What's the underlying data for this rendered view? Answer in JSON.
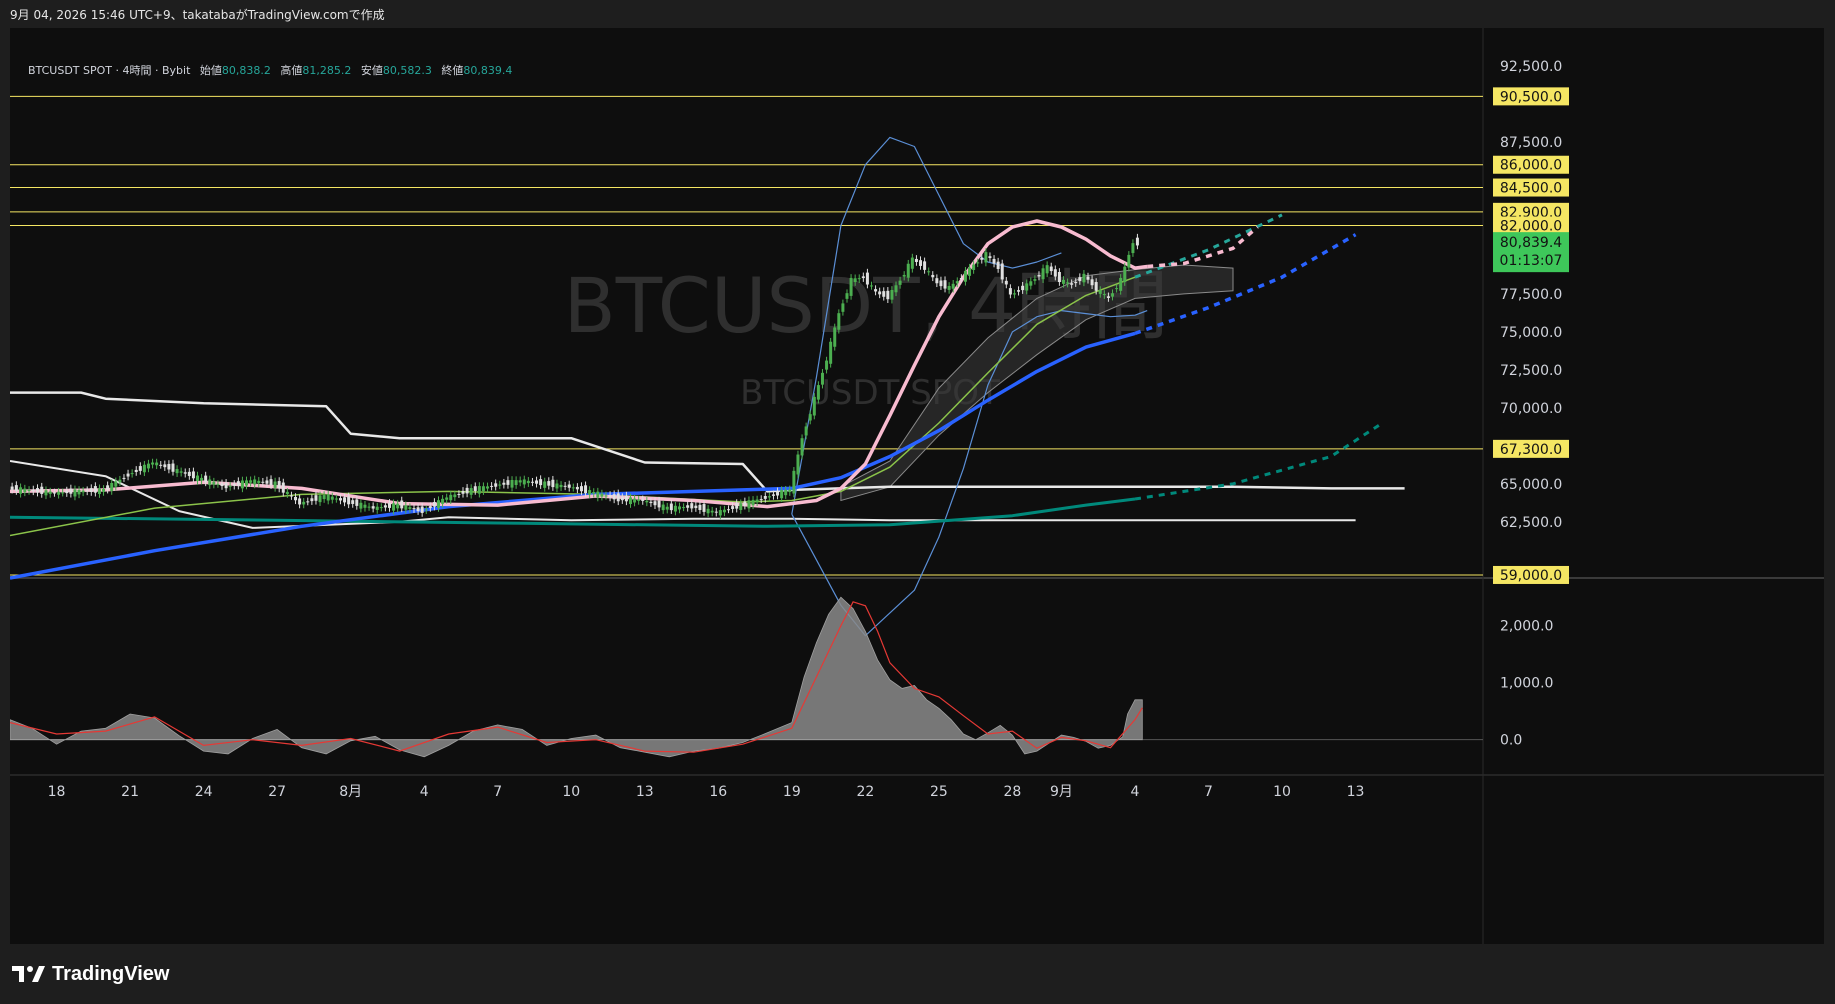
{
  "header": {
    "text": "9月 04, 2026 15:46 UTC+9、takatabaがTradingView.comで作成"
  },
  "legend": {
    "symbol": "BTCUSDT SPOT · 4時間 · Bybit",
    "open_label": "始値",
    "open": "80,838.2",
    "high_label": "高値",
    "high": "81,285.2",
    "low_label": "安値",
    "low": "80,582.3",
    "close_label": "終値",
    "close": "80,839.4"
  },
  "watermark": {
    "main": "BTCUSDT, 4時間",
    "sub": "BTCUSDT SPOT"
  },
  "footer": {
    "brand": "TradingView"
  },
  "colors": {
    "background": "#0e0e0e",
    "horizontal_line": "#f5e663",
    "up_candle": "#4caf50",
    "down_candle": "#e0e0e0",
    "pink_ma": "#f8bbd0",
    "blue_ma": "#2962ff",
    "teal_ma": "#00897b",
    "green_ma": "#8bc34a",
    "bollinger": "#5b8fd6",
    "histogram": "#8a8a8a",
    "signal": "#e53935",
    "last_price_tag": "#3ec75a"
  },
  "chart_data": {
    "type": "line",
    "title": "BTCUSDT, 4時間",
    "y_axis": {
      "ticks": [
        "92,500.0",
        "87,500.0",
        "77,500.0",
        "75,000.0",
        "72,500.0",
        "70,000.0",
        "65,000.0",
        "62,500.0"
      ],
      "tick_values": [
        92500,
        87500,
        77500,
        75000,
        72500,
        70000,
        65000,
        62500
      ],
      "range": [
        58800,
        95000
      ]
    },
    "x_axis": {
      "ticks": [
        "18",
        "21",
        "24",
        "27",
        "8月",
        "4",
        "7",
        "10",
        "13",
        "16",
        "19",
        "22",
        "25",
        "28",
        "9月",
        "4",
        "7",
        "10",
        "13"
      ],
      "tick_days": [
        -44,
        -41,
        -38,
        -35,
        -32,
        -29,
        -26,
        -23,
        -20,
        -17,
        -14,
        -11,
        -8,
        -5,
        -3,
        0,
        3,
        6,
        9
      ],
      "range_days": [
        -45.9,
        14.2
      ]
    },
    "horizontal_levels": [
      {
        "label": "90,500.0",
        "value": 90500
      },
      {
        "label": "86,000.0",
        "value": 86000
      },
      {
        "label": "84,500.0",
        "value": 84500
      },
      {
        "label": "82,900.0",
        "value": 82900
      },
      {
        "label": "82,000.0",
        "value": 82000
      },
      {
        "label": "67,300.0",
        "value": 67300
      },
      {
        "label": "59,000.0",
        "value": 59000
      }
    ],
    "last_price": {
      "label": "80,839.4",
      "countdown": "01:13:07",
      "value": 80839.4
    },
    "price_series": {
      "name": "BTCUSDT",
      "days": [
        -45.9,
        -44,
        -42,
        -41,
        -40,
        -38,
        -37,
        -36,
        -35,
        -34,
        -33,
        -32,
        -31,
        -30,
        -29,
        -28,
        -27,
        -26,
        -25,
        -24,
        -23,
        -22,
        -21,
        -20,
        -19,
        -18,
        -17,
        -16,
        -15,
        -14,
        -13.5,
        -13,
        -12.5,
        -12,
        -11.5,
        -11,
        -10.5,
        -10,
        -9.5,
        -9,
        -8.5,
        -8,
        -7.5,
        -7,
        -6.5,
        -6,
        -5.5,
        -5,
        -4.5,
        -4,
        -3.5,
        -3,
        -2.5,
        -2,
        -1.5,
        -1,
        -0.5,
        0,
        0.2
      ],
      "values": [
        64700,
        64400,
        64600,
        65600,
        66400,
        65300,
        64800,
        65200,
        65000,
        63700,
        64200,
        63800,
        63400,
        63600,
        63200,
        64100,
        64600,
        64900,
        65200,
        65000,
        64800,
        64400,
        64000,
        63900,
        63400,
        63500,
        63100,
        63600,
        64100,
        64600,
        68000,
        70600,
        73200,
        76200,
        78400,
        78600,
        77600,
        77300,
        78400,
        79800,
        79200,
        78200,
        77900,
        78600,
        79400,
        80100,
        79200,
        77400,
        77900,
        78500,
        79300,
        78400,
        78100,
        78700,
        77800,
        77200,
        78400,
        80900,
        80839
      ]
    },
    "pink_ma": {
      "days": [
        -45.9,
        -42,
        -38,
        -34,
        -30,
        -26,
        -22,
        -18,
        -15,
        -13,
        -12,
        -11,
        -10,
        -9,
        -8,
        -7,
        -6,
        -5,
        -4,
        -3,
        -2,
        -1,
        0,
        0.5
      ],
      "values": [
        64500,
        64600,
        65100,
        64700,
        63700,
        63600,
        64200,
        63900,
        63500,
        63900,
        64700,
        66300,
        69500,
        72800,
        76000,
        78600,
        80800,
        81900,
        82300,
        81900,
        81100,
        80000,
        79200,
        79300
      ]
    },
    "pink_ma_projection": {
      "days": [
        0.5,
        2,
        4,
        5
      ],
      "values": [
        79300,
        79500,
        80500,
        81900
      ]
    },
    "blue_ma": {
      "days": [
        -45.9,
        -40,
        -34,
        -28,
        -22,
        -16,
        -14,
        -12,
        -10,
        -8,
        -6,
        -4,
        -2,
        0
      ],
      "values": [
        58800,
        60600,
        62200,
        63500,
        64300,
        64600,
        64700,
        65400,
        66800,
        68500,
        70500,
        72400,
        74000,
        74900
      ]
    },
    "blue_ma_projection": {
      "days": [
        0,
        3,
        6,
        9
      ],
      "values": [
        74900,
        76600,
        78600,
        81400
      ]
    },
    "green_ma": {
      "days": [
        -45.9,
        -40,
        -34,
        -28,
        -22,
        -16,
        -14,
        -12,
        -10,
        -8,
        -6,
        -4,
        -2,
        0
      ],
      "values": [
        61600,
        63400,
        64300,
        64500,
        64300,
        63800,
        63900,
        64500,
        66100,
        69000,
        72300,
        75500,
        77400,
        78600
      ]
    },
    "green_ma_projection": {
      "days": [
        0,
        3,
        6
      ],
      "values": [
        78600,
        80400,
        82700
      ]
    },
    "teal_ma": {
      "days": [
        -45.9,
        -35,
        -25,
        -15,
        -10,
        -5,
        -2,
        0
      ],
      "values": [
        62800,
        62600,
        62400,
        62200,
        62300,
        62900,
        63600,
        64000
      ]
    },
    "teal_ma_projection": {
      "days": [
        0,
        4,
        8,
        10
      ],
      "values": [
        64000,
        65000,
        66800,
        68900
      ]
    },
    "white_step_line": {
      "days": [
        -45.9,
        -43,
        -42,
        -38,
        -33,
        -32,
        -30,
        -23,
        -20,
        -16,
        -15,
        -14,
        -10,
        -6,
        -3,
        -3,
        1,
        4,
        8,
        11
      ],
      "values": [
        71000,
        71000,
        70600,
        70300,
        70100,
        68300,
        68000,
        68000,
        66400,
        66300,
        64500,
        64600,
        64800,
        64800,
        64800,
        64800,
        64800,
        64800,
        64700,
        64700
      ]
    },
    "white_lower_line": {
      "days": [
        -45.9,
        -42,
        -39,
        -36,
        -30,
        -28,
        -23,
        -18,
        -14,
        -10,
        -4,
        0,
        4,
        9
      ],
      "values": [
        66500,
        65500,
        63200,
        62100,
        62500,
        62800,
        62600,
        62700,
        62700,
        62600,
        62600,
        62600,
        62600,
        62600
      ]
    },
    "bollinger_upper": {
      "days": [
        -14,
        -13,
        -12,
        -11,
        -10,
        -9,
        -8,
        -7,
        -6,
        -5,
        -4,
        -3
      ],
      "values": [
        63000,
        72000,
        82000,
        86000,
        87800,
        87200,
        84000,
        80800,
        79600,
        79200,
        79600,
        80200
      ]
    },
    "bollinger_lower": {
      "days": [
        -14,
        -13,
        -12,
        -11,
        -10,
        -9,
        -8,
        -7,
        -6,
        -5,
        -4,
        -3,
        -2,
        -1,
        0,
        0.5
      ],
      "values": [
        63000,
        60000,
        57000,
        55000,
        56500,
        58000,
        61500,
        66000,
        71500,
        75000,
        76000,
        76400,
        76200,
        76000,
        76100,
        76400
      ]
    },
    "cloud_upper": {
      "days": [
        -12,
        -10,
        -8,
        -6,
        -4,
        -2,
        0,
        2,
        4
      ],
      "values": [
        64800,
        66500,
        71300,
        74600,
        77200,
        78700,
        79100,
        79400,
        79200
      ]
    },
    "cloud_lower": {
      "days": [
        -12,
        -10,
        -8,
        -6,
        -4,
        -2,
        0,
        2,
        4
      ],
      "values": [
        63900,
        64800,
        68200,
        71000,
        73500,
        75800,
        77200,
        77500,
        77700
      ]
    },
    "oscillator": {
      "name": "oscillator",
      "y_ticks": [
        "2,000.0",
        "1,000.0",
        "0.0"
      ],
      "y_tick_values": [
        2000,
        1000,
        0
      ],
      "range": [
        -620,
        2820
      ],
      "days": [
        -45.9,
        -45,
        -44,
        -43,
        -42,
        -41,
        -40,
        -39,
        -38,
        -37,
        -36,
        -35,
        -34,
        -33,
        -32,
        -31,
        -30,
        -29,
        -28,
        -27,
        -26,
        -25,
        -24,
        -23,
        -22,
        -21,
        -20,
        -19,
        -18,
        -17,
        -16,
        -15,
        -14,
        -13.5,
        -13,
        -12.5,
        -12,
        -11.5,
        -11,
        -10.5,
        -10,
        -9.5,
        -9,
        -8.5,
        -8,
        -7.5,
        -7,
        -6.5,
        -6,
        -5.5,
        -5,
        -4.5,
        -4,
        -3.5,
        -3,
        -2.5,
        -2,
        -1.5,
        -1,
        -0.5,
        -0.3,
        0,
        0.3
      ],
      "values": [
        350,
        200,
        -80,
        150,
        200,
        450,
        380,
        70,
        -200,
        -250,
        20,
        180,
        -140,
        -250,
        -20,
        60,
        -180,
        -300,
        -100,
        150,
        260,
        180,
        -100,
        20,
        80,
        -140,
        -220,
        -300,
        -200,
        -150,
        -50,
        120,
        300,
        1100,
        1700,
        2200,
        2500,
        2300,
        1900,
        1400,
        1050,
        900,
        950,
        700,
        550,
        350,
        100,
        0,
        120,
        250,
        80,
        -250,
        -200,
        -60,
        80,
        40,
        -30,
        -150,
        -100,
        50,
        450,
        700,
        700
      ]
    },
    "signal": {
      "days": [
        -45.9,
        -44,
        -42,
        -40,
        -38,
        -36,
        -34,
        -32,
        -30,
        -28,
        -26,
        -24,
        -22,
        -20,
        -18,
        -16,
        -14,
        -13,
        -12,
        -11.5,
        -11,
        -10.5,
        -10,
        -9,
        -8,
        -7,
        -6,
        -5,
        -4,
        -3,
        -2,
        -1,
        0,
        0.3
      ],
      "values": [
        300,
        100,
        150,
        400,
        -100,
        0,
        -100,
        20,
        -200,
        100,
        220,
        -50,
        0,
        -200,
        -220,
        -80,
        200,
        1100,
        2000,
        2420,
        2350,
        1900,
        1350,
        900,
        750,
        420,
        100,
        150,
        -150,
        40,
        -20,
        -140,
        350,
        560
      ]
    }
  }
}
